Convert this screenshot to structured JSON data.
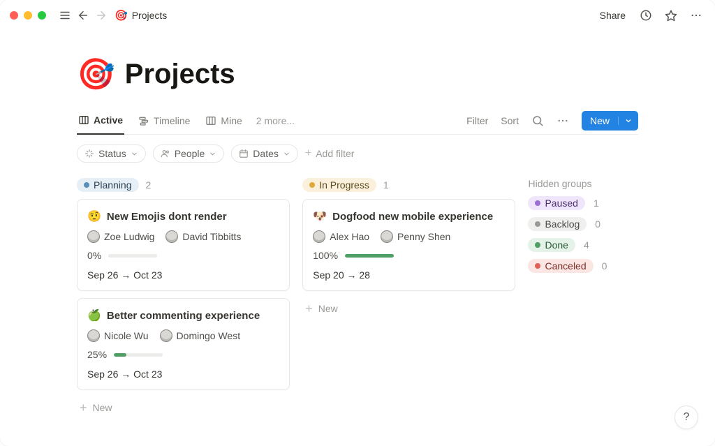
{
  "topbar": {
    "crumb_emoji": "🎯",
    "crumb_title": "Projects",
    "share_label": "Share"
  },
  "page": {
    "title_emoji": "🎯",
    "title": "Projects"
  },
  "viewbar": {
    "tabs": [
      {
        "label": "Active",
        "active": true
      },
      {
        "label": "Timeline",
        "active": false
      },
      {
        "label": "Mine",
        "active": false
      }
    ],
    "more_label": "2 more...",
    "filter_label": "Filter",
    "sort_label": "Sort",
    "new_label": "New"
  },
  "filters": {
    "status": "Status",
    "people": "People",
    "dates": "Dates",
    "add_filter": "Add filter"
  },
  "board": {
    "columns": [
      {
        "status": "Planning",
        "pillClass": "pill-planning",
        "count": "2",
        "cards": [
          {
            "emoji": "🤨",
            "title": "New Emojis dont  render",
            "people": [
              {
                "name": "Zoe Ludwig"
              },
              {
                "name": "David Tibbitts"
              }
            ],
            "progress_label": "0%",
            "progress_pct": 0,
            "dates": "Sep 26 → Oct 23"
          },
          {
            "emoji": "🍏",
            "title": "Better commenting experience",
            "people": [
              {
                "name": "Nicole Wu"
              },
              {
                "name": "Domingo West"
              }
            ],
            "progress_label": "25%",
            "progress_pct": 25,
            "dates": "Sep 26 → Oct 23"
          }
        ],
        "new_label": "New"
      },
      {
        "status": "In Progress",
        "pillClass": "pill-inprogress",
        "count": "1",
        "cards": [
          {
            "emoji": "🐶",
            "title": "Dogfood new mobile experience",
            "people": [
              {
                "name": "Alex Hao"
              },
              {
                "name": "Penny Shen"
              }
            ],
            "progress_label": "100%",
            "progress_pct": 100,
            "dates": "Sep 20 → 28"
          }
        ],
        "new_label": "New"
      }
    ]
  },
  "hidden": {
    "title": "Hidden groups",
    "groups": [
      {
        "label": "Paused",
        "pillClass": "pill-paused",
        "count": "1"
      },
      {
        "label": "Backlog",
        "pillClass": "pill-backlog",
        "count": "0"
      },
      {
        "label": "Done",
        "pillClass": "pill-done",
        "count": "4"
      },
      {
        "label": "Canceled",
        "pillClass": "pill-canceled",
        "count": "0"
      }
    ]
  },
  "help": "?"
}
